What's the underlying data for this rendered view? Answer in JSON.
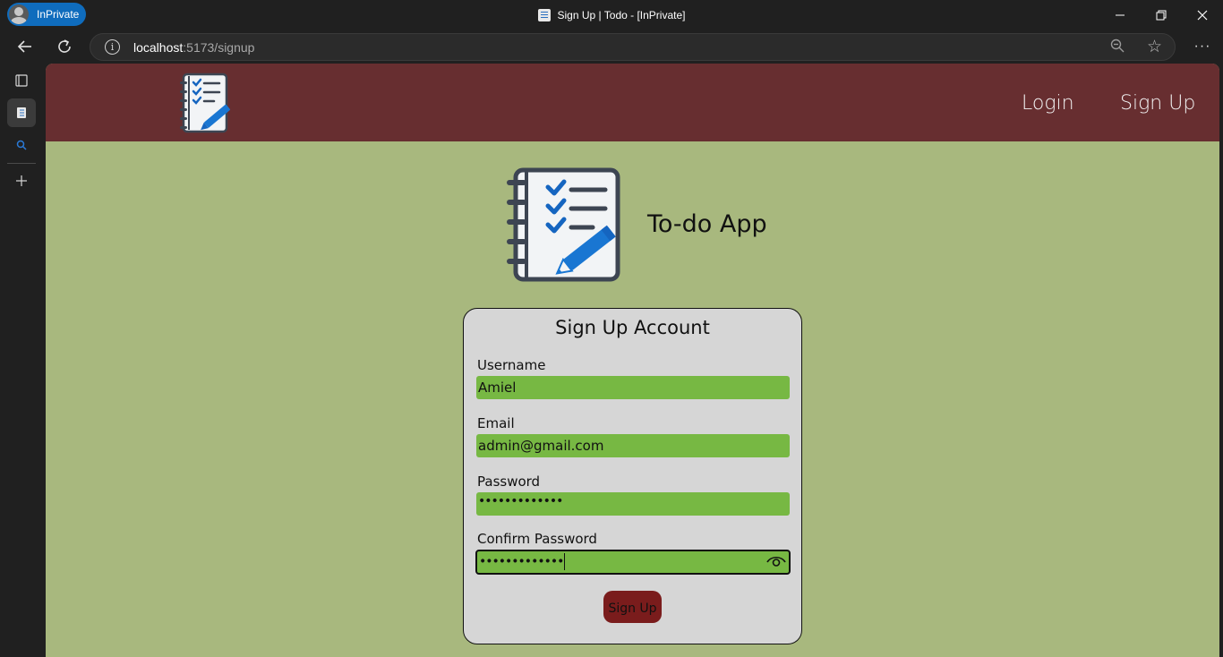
{
  "browser": {
    "inprivate_label": "InPrivate",
    "window_title": "Sign Up | Todo - [InPrivate]",
    "url_host": "localhost",
    "url_rest": ":5173/signup"
  },
  "nav": {
    "login": "Login",
    "signup": "Sign Up"
  },
  "brand": {
    "title": "To-do App"
  },
  "form": {
    "title": "Sign Up Account",
    "username_label": "Username",
    "username_value": "Amiel",
    "email_label": "Email",
    "email_value": "admin@gmail.com",
    "password_label": "Password",
    "password_value": "•••••••••••••",
    "confirm_label": "Confirm Password",
    "confirm_value": "•••••••••••••",
    "submit_label": "Sign Up"
  },
  "colors": {
    "navbar": "#672e30",
    "page_bg": "#a8b87e",
    "input_bg": "#77b843",
    "button_bg": "#7a1c1c",
    "card_bg": "#d6d6d6"
  },
  "icons": [
    "profile-avatar-icon",
    "todo-favicon-icon",
    "minimize-icon",
    "restore-icon",
    "close-icon",
    "back-arrow-icon",
    "refresh-icon",
    "site-info-icon",
    "zoom-out-icon",
    "favorite-star-icon",
    "more-options-icon",
    "tab-actions-icon",
    "active-tab-icon",
    "search-tab-icon",
    "new-tab-icon",
    "todo-logo-icon",
    "show-password-eye-icon"
  ]
}
